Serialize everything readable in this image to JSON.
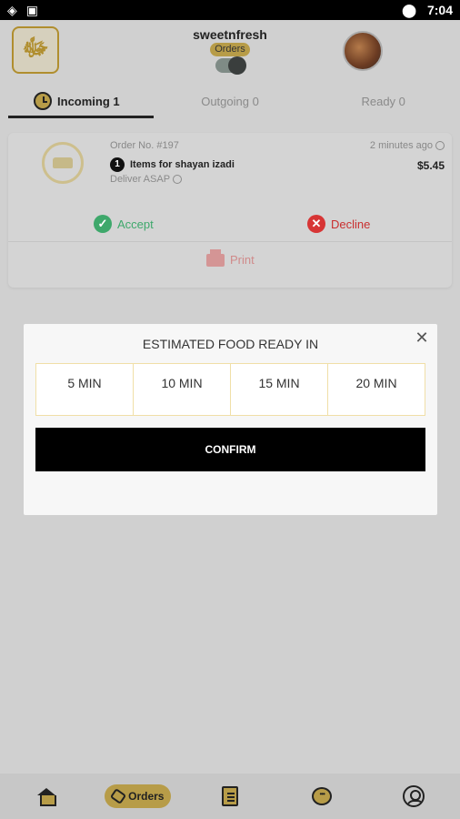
{
  "status_bar": {
    "time": "7:04"
  },
  "header": {
    "store_name": "sweetnfresh",
    "orders_badge": "Orders"
  },
  "tabs": [
    {
      "label": "Incoming 1",
      "active": true
    },
    {
      "label": "Outgoing 0",
      "active": false
    },
    {
      "label": "Ready 0",
      "active": false
    }
  ],
  "order": {
    "order_no": "Order No. #197",
    "item_count": "1",
    "items_text": "Items for shayan izadi",
    "deliver": "Deliver ASAP",
    "time_ago": "2 minutes ago",
    "price": "$5.45",
    "accept_label": "Accept",
    "decline_label": "Decline",
    "print_label": "Print"
  },
  "modal": {
    "title": "ESTIMATED FOOD READY IN",
    "options": [
      "5 MIN",
      "10 MIN",
      "15 MIN",
      "20 MIN"
    ],
    "confirm_label": "CONFIRM"
  },
  "bottom_nav": {
    "orders_label": "Orders"
  },
  "colors": {
    "accent_gold": "#b79c48",
    "accept_green": "#3ea86b",
    "decline_red": "#d73535",
    "confirm_black": "#000000"
  }
}
